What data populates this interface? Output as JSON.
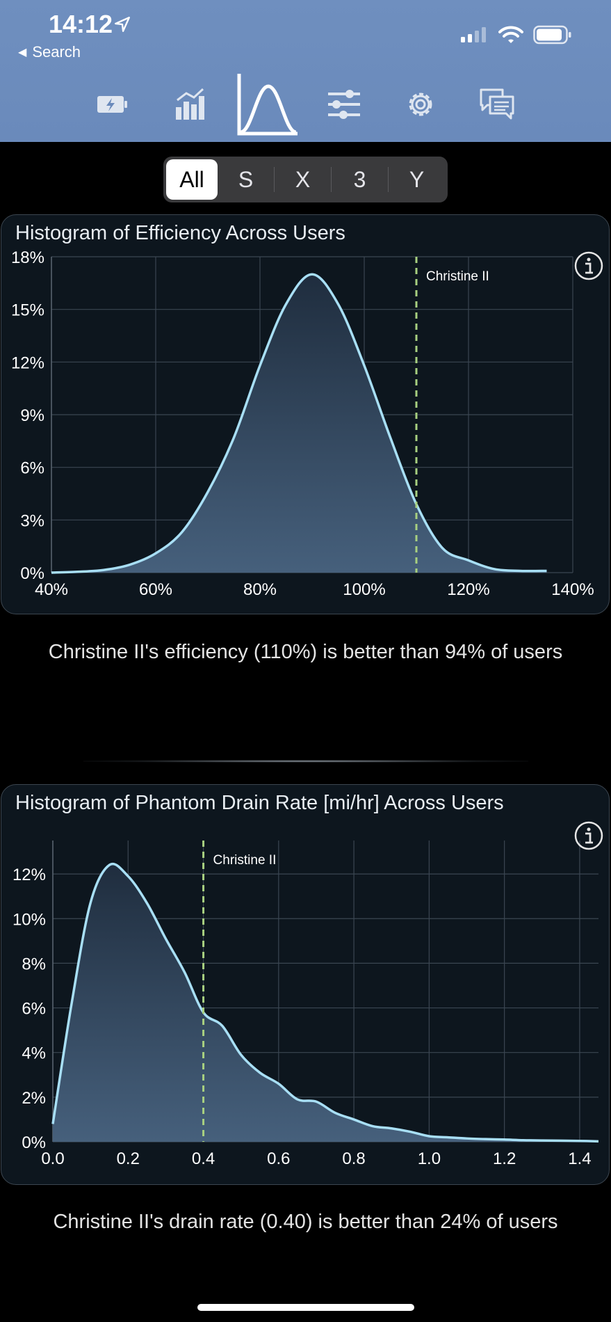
{
  "status_bar": {
    "time": "14:12",
    "back_label": "Search"
  },
  "nav_tabs": [
    {
      "icon": "battery-charging-icon"
    },
    {
      "icon": "bar-chart-icon"
    },
    {
      "icon": "bell-curve-icon",
      "selected": true
    },
    {
      "icon": "sliders-icon"
    },
    {
      "icon": "gear-icon"
    },
    {
      "icon": "chat-icon"
    }
  ],
  "segments": {
    "items": [
      "All",
      "S",
      "X",
      "3",
      "Y"
    ],
    "selected": "All"
  },
  "colors": {
    "topbar": "#6a8abb",
    "curve": "#a8dff5",
    "marker": "#a8d080",
    "card_bg": "#0d161e"
  },
  "histograms": [
    {
      "title": "Histogram of Efficiency Across Users",
      "marker_label": "Christine II",
      "caption": "Christine II's efficiency (110%) is better than 94% of users"
    },
    {
      "title": "Histogram of Phantom Drain Rate [mi/hr] Across Users",
      "marker_label": "Christine II",
      "caption": "Christine II's drain rate (0.40) is better than 24% of users"
    }
  ],
  "chart_data": [
    {
      "type": "area",
      "title": "Histogram of Efficiency Across Users",
      "xlabel": "",
      "ylabel": "",
      "xlim": [
        40,
        140
      ],
      "ylim": [
        0,
        18
      ],
      "x_ticks": [
        "40%",
        "60%",
        "80%",
        "100%",
        "120%",
        "140%"
      ],
      "y_ticks": [
        "0%",
        "3%",
        "6%",
        "9%",
        "12%",
        "15%",
        "18%"
      ],
      "grid": true,
      "series": [
        {
          "x": [
            40,
            45,
            50,
            55,
            60,
            65,
            70,
            75,
            80,
            85,
            90,
            95,
            100,
            105,
            110,
            115,
            120,
            125,
            130,
            135
          ],
          "y": [
            0,
            0.05,
            0.15,
            0.45,
            1.1,
            2.3,
            4.6,
            7.7,
            11.8,
            15.3,
            17.0,
            15.3,
            11.8,
            7.7,
            3.9,
            1.4,
            0.7,
            0.2,
            0.1,
            0.1
          ]
        }
      ],
      "marker": {
        "x": 110,
        "label": "Christine II"
      }
    },
    {
      "type": "area",
      "title": "Histogram of Phantom Drain Rate [mi/hr] Across Users",
      "xlabel": "",
      "ylabel": "",
      "xlim": [
        0,
        1.45
      ],
      "ylim": [
        0,
        13.5
      ],
      "x_ticks": [
        "0.0",
        "0.2",
        "0.4",
        "0.6",
        "0.8",
        "1.0",
        "1.2",
        "1.4"
      ],
      "y_ticks": [
        "0%",
        "2%",
        "4%",
        "6%",
        "8%",
        "10%",
        "12%"
      ],
      "grid": true,
      "series": [
        {
          "x": [
            0.0,
            0.05,
            0.1,
            0.15,
            0.2,
            0.25,
            0.3,
            0.35,
            0.4,
            0.45,
            0.5,
            0.55,
            0.6,
            0.65,
            0.7,
            0.75,
            0.8,
            0.85,
            0.9,
            0.95,
            1.0,
            1.05,
            1.1,
            1.15,
            1.2,
            1.25,
            1.3,
            1.35,
            1.4,
            1.45
          ],
          "y": [
            0.8,
            6.2,
            10.7,
            12.4,
            11.9,
            10.7,
            9.1,
            7.6,
            5.8,
            5.2,
            3.9,
            3.1,
            2.6,
            1.9,
            1.8,
            1.3,
            1.0,
            0.7,
            0.6,
            0.45,
            0.25,
            0.2,
            0.15,
            0.12,
            0.1,
            0.07,
            0.06,
            0.05,
            0.04,
            0.02
          ]
        }
      ],
      "marker": {
        "x": 0.4,
        "label": "Christine II"
      }
    }
  ]
}
